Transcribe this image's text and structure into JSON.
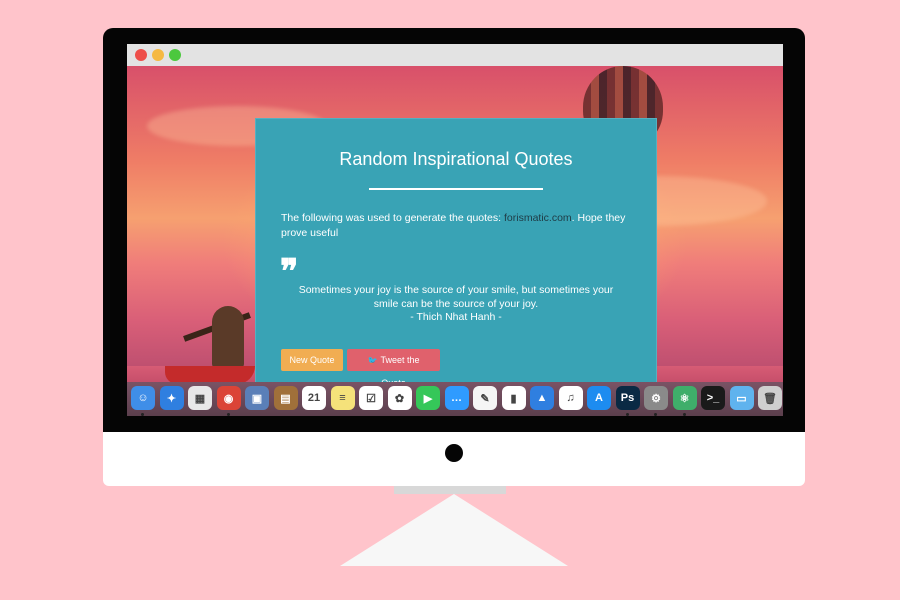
{
  "window": {
    "controls": [
      "close",
      "minimize",
      "maximize"
    ]
  },
  "card": {
    "title": "Random Inspirational Quotes",
    "intro_prefix": "The following was used to generate the quotes: ",
    "intro_link": "forismatic.com",
    "intro_suffix": ". Hope they prove useful",
    "quote_mark": "❞",
    "quote_text": "Sometimes your joy is the source of your smile, but sometimes your smile can be the source of your joy.",
    "author": "- Thich Nhat Hanh -",
    "new_quote_label": "New Quote",
    "tweet_label": "Tweet the Quote",
    "tweet_icon": "twitter-bird-icon"
  },
  "dock": {
    "apps": [
      {
        "name": "finder-icon",
        "color": "#3f8ee8",
        "glyph": "☺"
      },
      {
        "name": "safari-icon",
        "color": "#2f7fe0",
        "glyph": "✦"
      },
      {
        "name": "launchpad-icon",
        "color": "#e8e8e8",
        "glyph": "▦"
      },
      {
        "name": "chrome-icon",
        "color": "#db4437",
        "glyph": "◉"
      },
      {
        "name": "preview-icon",
        "color": "#5a7fb8",
        "glyph": "▣"
      },
      {
        "name": "notebook-icon",
        "color": "#a0703a",
        "glyph": "▤"
      },
      {
        "name": "calendar-icon",
        "color": "#ffffff",
        "glyph": "21"
      },
      {
        "name": "notes-icon",
        "color": "#f5e27a",
        "glyph": "≡"
      },
      {
        "name": "reminders-icon",
        "color": "#ffffff",
        "glyph": "☑"
      },
      {
        "name": "photos-icon",
        "color": "#ffffff",
        "glyph": "✿"
      },
      {
        "name": "facetime-icon",
        "color": "#35c759",
        "glyph": "▶"
      },
      {
        "name": "messages-icon",
        "color": "#2f9bff",
        "glyph": "…"
      },
      {
        "name": "textedit-icon",
        "color": "#f5f5f5",
        "glyph": "✎"
      },
      {
        "name": "numbers-icon",
        "color": "#ffffff",
        "glyph": "▮"
      },
      {
        "name": "keynote-icon",
        "color": "#2f7fe0",
        "glyph": "▲"
      },
      {
        "name": "itunes-icon",
        "color": "#ffffff",
        "glyph": "♫"
      },
      {
        "name": "app-store-icon",
        "color": "#1d8cf0",
        "glyph": "A"
      },
      {
        "name": "photoshop-icon",
        "color": "#0a2a44",
        "glyph": "Ps"
      },
      {
        "name": "system-preferences-icon",
        "color": "#8a8a8a",
        "glyph": "⚙"
      },
      {
        "name": "atom-icon",
        "color": "#3fae6a",
        "glyph": "⚛"
      },
      {
        "name": "terminal-icon",
        "color": "#1a1a1a",
        "glyph": ">_"
      },
      {
        "name": "folder-icon",
        "color": "#5fb3ee",
        "glyph": "▭"
      },
      {
        "name": "trash-icon",
        "color": "#cfcfcf",
        "glyph": "🗑"
      }
    ]
  }
}
